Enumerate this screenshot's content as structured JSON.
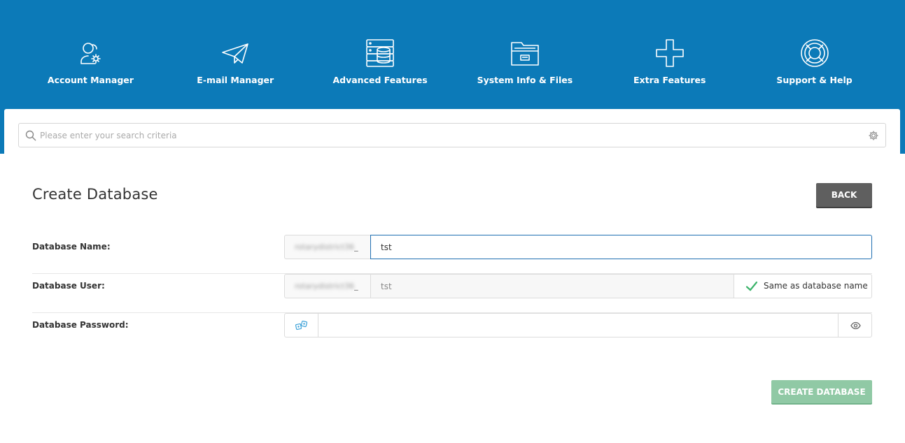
{
  "nav": {
    "items": [
      {
        "label": "Account Manager",
        "icon": "account-manager-icon"
      },
      {
        "label": "E-mail Manager",
        "icon": "paper-plane-icon"
      },
      {
        "label": "Advanced Features",
        "icon": "server-database-icon"
      },
      {
        "label": "System Info & Files",
        "icon": "folder-icon"
      },
      {
        "label": "Extra Features",
        "icon": "plus-icon"
      },
      {
        "label": "Support & Help",
        "icon": "lifebuoy-icon"
      }
    ]
  },
  "search": {
    "placeholder": "Please enter your search criteria",
    "value": ""
  },
  "page": {
    "title": "Create Database",
    "back_label": "BACK"
  },
  "form": {
    "name_label": "Database Name:",
    "name_prefix": "rotarydistrict36",
    "name_prefix_suffix": "_",
    "name_value": "tst",
    "user_label": "Database User:",
    "user_prefix": "rotarydistrict36",
    "user_prefix_suffix": "_",
    "user_value": "tst",
    "same_as_label": "Same as database name",
    "same_as_checked": true,
    "password_label": "Database Password:",
    "password_value": ""
  },
  "actions": {
    "create_label": "CREATE DATABASE"
  },
  "colors": {
    "header_blue": "#0c7ab8",
    "back_button": "#5f5f5f",
    "create_button": "#90c9a5",
    "check_green": "#3bb36a"
  }
}
